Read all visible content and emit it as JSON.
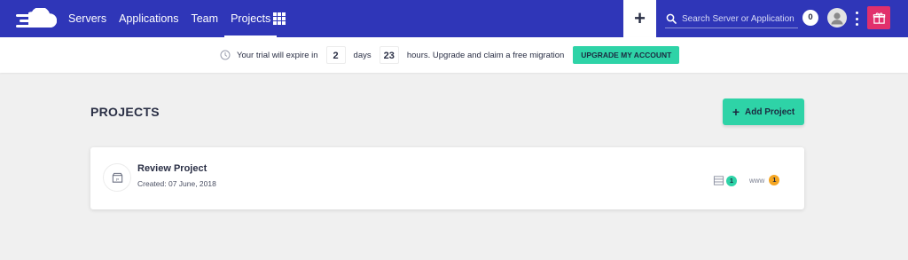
{
  "nav": {
    "items": [
      {
        "label": "Servers",
        "active": false
      },
      {
        "label": "Applications",
        "active": false
      },
      {
        "label": "Team",
        "active": false
      },
      {
        "label": "Projects",
        "active": true
      }
    ]
  },
  "header": {
    "add_icon": "plus-icon",
    "search_placeholder": "Search Server or Application",
    "notification_count": "0",
    "colors": {
      "topbar": "#2f36b8",
      "gift": "#e1306c",
      "accent": "#2ed3a7"
    }
  },
  "trial": {
    "text_before": "Your trial will expire in",
    "days_value": "2",
    "days_label": "days",
    "hours_value": "23",
    "hours_text": "hours. Upgrade and claim a free migration",
    "upgrade_label": "UPGRADE MY ACCOUNT"
  },
  "main": {
    "title": "PROJECTS",
    "add_label": "Add Project",
    "projects": [
      {
        "name": "Review Project",
        "created": "Created: 07 June, 2018",
        "server_count": "1",
        "www_label": "www",
        "app_count": "1"
      }
    ]
  }
}
